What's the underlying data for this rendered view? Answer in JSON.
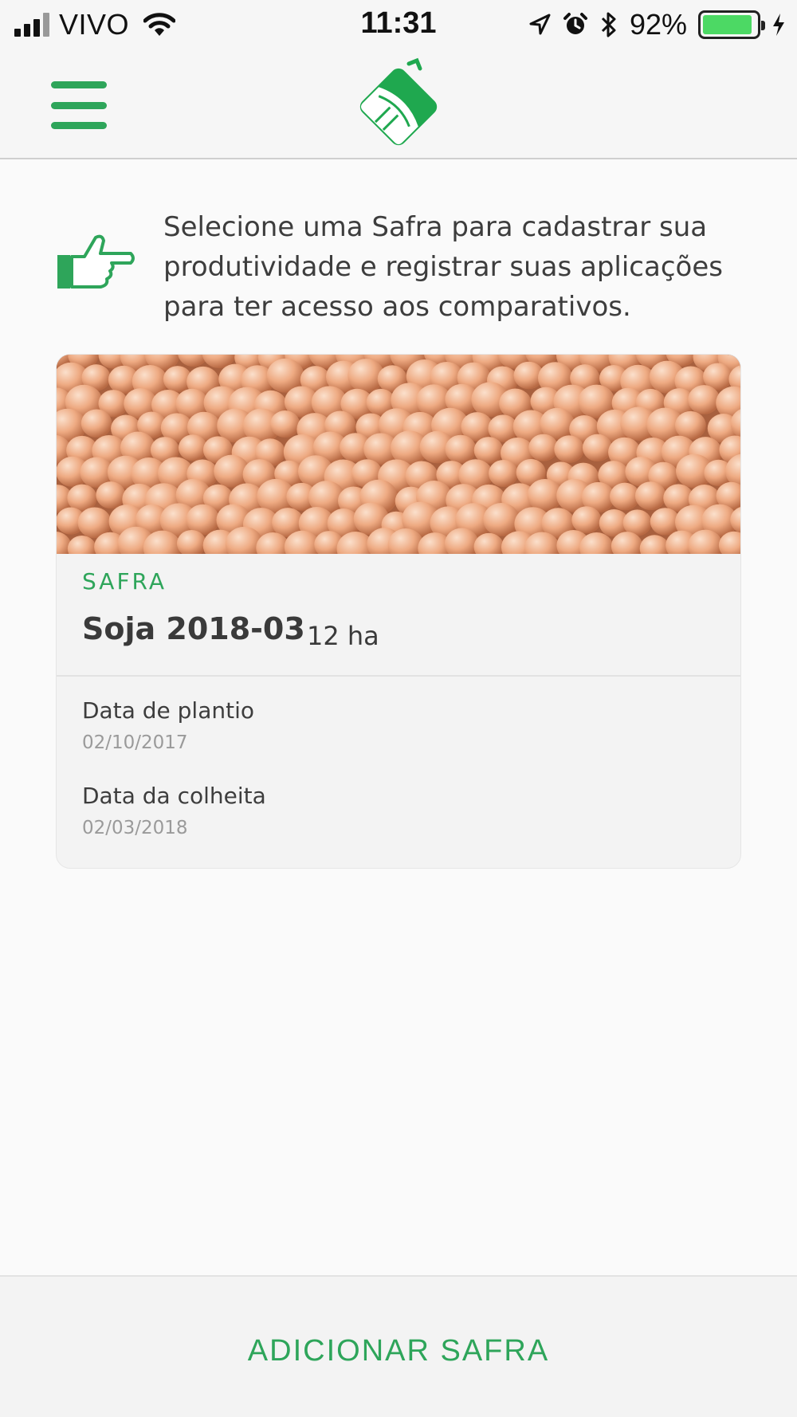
{
  "status_bar": {
    "carrier": "VIVO",
    "time": "11:31",
    "battery_percent": "92%",
    "battery_level": 0.92,
    "icons": [
      "signal-icon",
      "wifi-icon",
      "location-arrow-icon",
      "alarm-icon",
      "bluetooth-icon",
      "battery-icon",
      "charging-bolt-icon"
    ]
  },
  "header": {
    "menu_icon": "hamburger-menu-icon",
    "logo_icon": "app-logo-icon"
  },
  "hint": {
    "icon": "pointing-hand-icon",
    "text": "Selecione uma Safra para cadastrar sua produtividade e registrar suas aplicações para ter acesso aos comparativos."
  },
  "card": {
    "image": "soybeans-photo",
    "label": "SAFRA",
    "title": "Soja 2018-03",
    "area": "12 ha",
    "fields": [
      {
        "label": "Data de plantio",
        "value": "02/10/2017"
      },
      {
        "label": "Data da colheita",
        "value": "02/03/2018"
      }
    ]
  },
  "footer": {
    "add_button": "ADICIONAR SAFRA"
  },
  "colors": {
    "accent": "#2ea55a",
    "battery": "#4cd964",
    "card_bg": "#f3f3f3",
    "page_bg": "#fafafa"
  }
}
